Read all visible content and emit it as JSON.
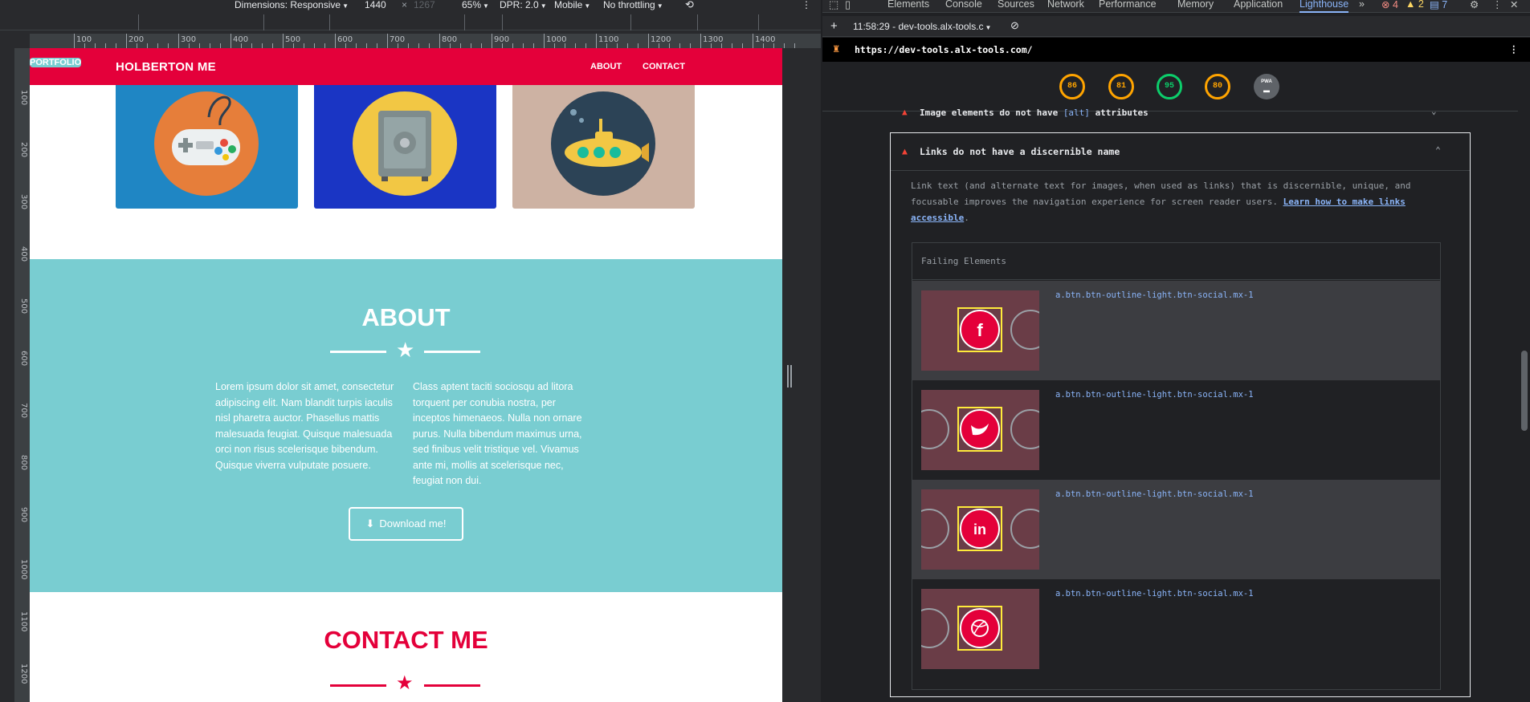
{
  "device_toolbar": {
    "dimensions_label": "Dimensions: Responsive",
    "width": "1440",
    "times": "×",
    "height": "1267",
    "zoom": "65%",
    "dpr": "DPR: 2.0",
    "device_type": "Mobile",
    "throttling": "No throttling"
  },
  "ruler": {
    "h_labels": [
      "100",
      "200",
      "300",
      "400",
      "500",
      "600",
      "700",
      "800",
      "900",
      "1000",
      "1100",
      "1200",
      "1300",
      "1400"
    ],
    "v_labels": [
      "100",
      "200",
      "300",
      "400",
      "500",
      "600",
      "700",
      "800",
      "900",
      "1000",
      "1100",
      "1200"
    ]
  },
  "site": {
    "brand": "HOLBERTON ME",
    "nav": [
      "PORTFOLIO",
      "ABOUT",
      "CONTACT"
    ],
    "about_title": "ABOUT",
    "about_col1": "Lorem ipsum dolor sit amet, consectetur adipiscing elit. Nam blandit turpis iaculis nisl pharetra auctor. Phasellus mattis malesuada feugiat. Quisque malesuada orci non risus scelerisque bibendum. Quisque viverra vulputate posuere.",
    "about_col2": "Class aptent taciti sociosqu ad litora torquent per conubia nostra, per inceptos himenaeos. Nulla non ornare purus. Nulla bibendum maximus urna, sed finibus velit tristique vel. Vivamus ante mi, mollis at scelerisque nec, feugiat non dui.",
    "download_label": "Download me!",
    "contact_title": "CONTACT ME",
    "colors": {
      "brand_red": "#e4003a",
      "teal": "#79cdd1"
    }
  },
  "devtools": {
    "tabs": [
      "Elements",
      "Console",
      "Sources",
      "Network",
      "Performance",
      "Memory",
      "Application",
      "Lighthouse"
    ],
    "more_tabs": "»",
    "errors": "4",
    "warnings": "2",
    "messages": "7",
    "report_time": "11:58:29 - dev-tools.alx-tools.c",
    "url": "https://dev-tools.alx-tools.com/",
    "scores": [
      {
        "value": "86",
        "color": "#ffa400"
      },
      {
        "value": "81",
        "color": "#ffa400"
      },
      {
        "value": "95",
        "color": "#0cce6b"
      },
      {
        "value": "80",
        "color": "#ffa400"
      }
    ],
    "pwa_label": "PWA",
    "prev_audit_prefix": "Image elements do not have",
    "prev_audit_code": "[alt]",
    "prev_audit_suffix": "attributes",
    "audit_title": "Links do not have a discernible name",
    "audit_desc": "Link text (and alternate text for images, when used as links) that is discernible, unique, and focusable improves the navigation experience for screen reader users.",
    "audit_link": "Learn how to make links accessible",
    "audit_period": ".",
    "failing_header": "Failing Elements",
    "failing": [
      {
        "selector": "a.btn.btn-outline-light.btn-social.mx-1",
        "icon": "f"
      },
      {
        "selector": "a.btn.btn-outline-light.btn-social.mx-1",
        "icon": "twitter"
      },
      {
        "selector": "a.btn.btn-outline-light.btn-social.mx-1",
        "icon": "in"
      },
      {
        "selector": "a.btn.btn-outline-light.btn-social.mx-1",
        "icon": "dribbble"
      }
    ]
  }
}
